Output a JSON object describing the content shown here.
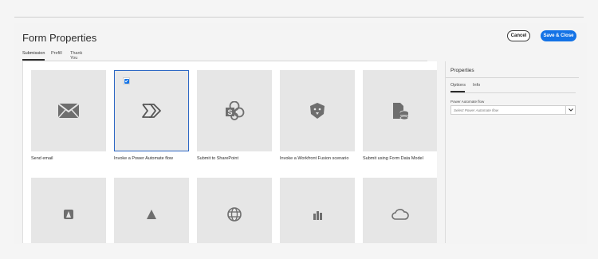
{
  "dialog": {
    "title": "Form Properties",
    "cancel_label": "Cancel",
    "save_label": "Save & Close"
  },
  "tabs": [
    {
      "label": "Submission",
      "active": true
    },
    {
      "label": "Prefill",
      "active": false
    },
    {
      "label": "Thank You",
      "active": false
    }
  ],
  "cards": [
    {
      "label": "Send email",
      "icon": "envelope-icon",
      "selected": false
    },
    {
      "label": "Invoke a Power Automate flow",
      "icon": "power-automate-icon",
      "selected": true
    },
    {
      "label": "Submit to SharePoint",
      "icon": "sharepoint-icon",
      "selected": false
    },
    {
      "label": "Invoke a Workfront Fusion scenario",
      "icon": "workfront-fusion-icon",
      "selected": false
    },
    {
      "label": "Submit using Form Data Model",
      "icon": "form-data-model-icon",
      "selected": false
    },
    {
      "label": "",
      "icon": "rest-endpoint-icon",
      "selected": false
    },
    {
      "label": "",
      "icon": "azure-blob-icon",
      "selected": false
    },
    {
      "label": "",
      "icon": "globe-icon",
      "selected": false
    },
    {
      "label": "",
      "icon": "bar-chart-icon",
      "selected": false
    },
    {
      "label": "",
      "icon": "cloud-icon",
      "selected": false
    }
  ],
  "properties": {
    "title": "Properties",
    "tabs": [
      {
        "label": "Options",
        "active": true
      },
      {
        "label": "Info",
        "active": false
      }
    ],
    "field_label": "Power Automate flow",
    "select_placeholder": "Select Power Automate flow"
  },
  "colors": {
    "accent": "#1473e6",
    "selected_border": "#2d68c4",
    "card_bg": "#e6e6e6",
    "icon": "#6e6e6e"
  }
}
